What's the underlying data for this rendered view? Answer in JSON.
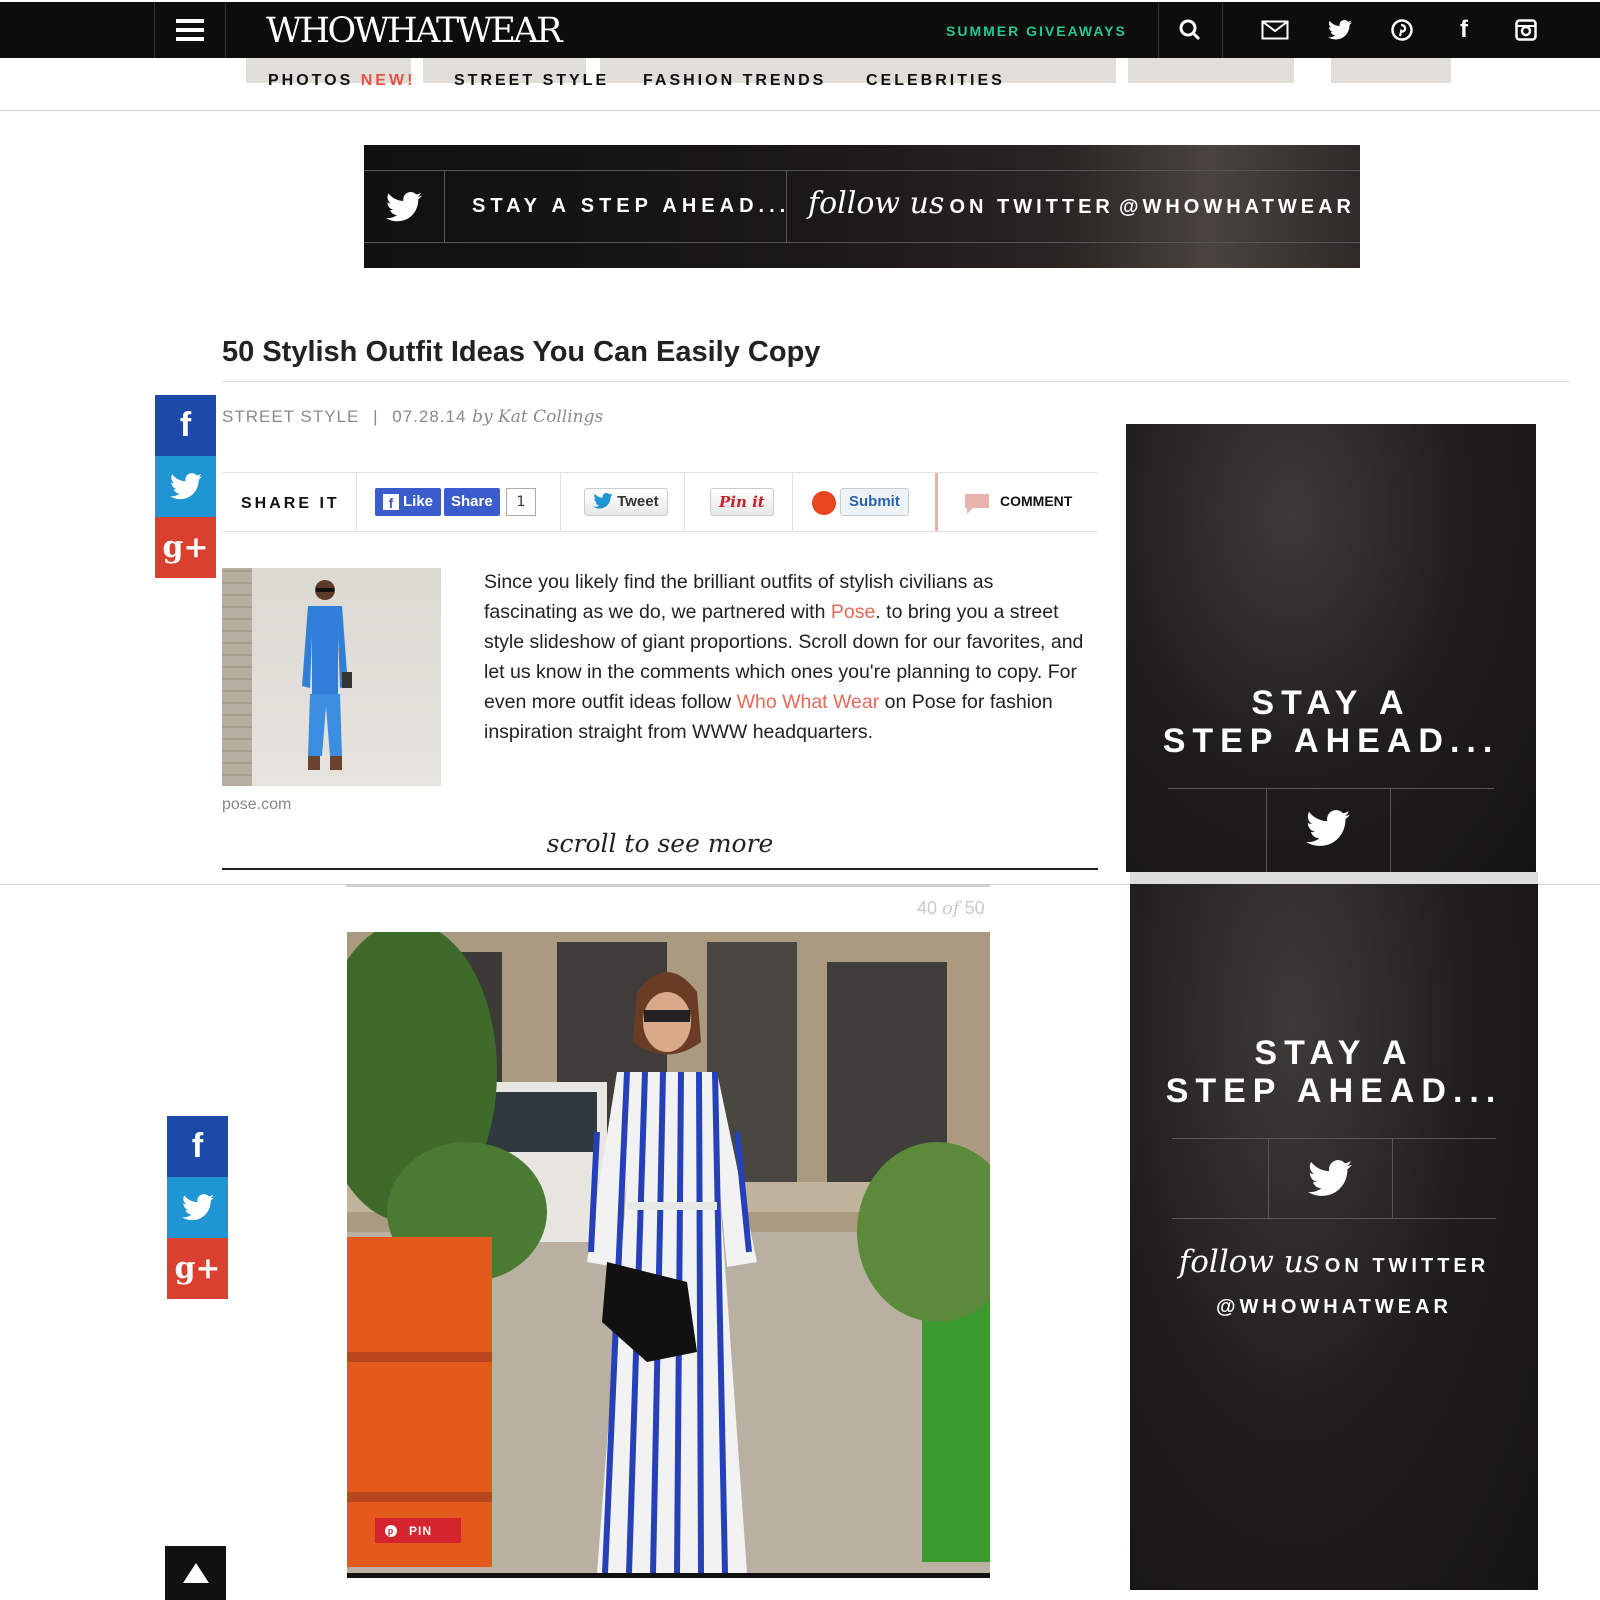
{
  "header": {
    "logo": "WHOWHATWEAR",
    "giveaways": "SUMMER GIVEAWAYS",
    "icons": [
      "menu-icon",
      "search-icon",
      "mail-icon",
      "twitter-icon",
      "pinterest-icon",
      "facebook-icon",
      "instagram-icon"
    ],
    "facebook_glyph": "f"
  },
  "nav": {
    "photos": "PHOTOS",
    "photos_badge": "NEW!",
    "street_style": "STREET STYLE",
    "fashion_trends": "FASHION TRENDS",
    "celebrities": "CELEBRITIES"
  },
  "banner": {
    "tagline": "STAY A STEP AHEAD...",
    "follow_script": "follow us",
    "follow_caps": "ON TWITTER",
    "handle": "@WHOWHATWEAR"
  },
  "article": {
    "title": "50 Stylish Outfit Ideas You Can Easily Copy",
    "category": "STREET STYLE",
    "separator": "|",
    "date": "07.28.14",
    "byline": "by Kat Collings",
    "share_label": "SHARE IT",
    "like_label": "Like",
    "share_button": "Share",
    "share_count": "1",
    "tweet_label": "Tweet",
    "pin_label": "Pin it",
    "submit_label": "Submit",
    "comment_label": "COMMENT",
    "image_source": "pose.com",
    "body_1": "Since you likely find the brilliant outfits of stylish civilians as fascinating as we do, we partnered with ",
    "body_link_1": "Pose",
    "body_2": ". to bring you a street style slideshow of giant proportions. Scroll down for our favorites, and let us know in the comments which ones you're planning to copy. For even more outfit ideas follow ",
    "body_link_2": "Who What Wear",
    "body_3": " on Pose for fashion inspiration straight from WWW headquarters.",
    "scroll_hint": "scroll to see more"
  },
  "social": {
    "facebook": "f",
    "googleplus": "g+"
  },
  "slideshow": {
    "current": "40",
    "of": "of",
    "total": "50",
    "pin_label": "PIN"
  },
  "ads": {
    "headline_line1": "STAY A",
    "headline_line2": "STEP AHEAD...",
    "follow_script": "follow us",
    "follow_caps": "ON TWITTER",
    "handle": "@WHOWHATWEAR"
  },
  "colors": {
    "accent_green": "#25c98f",
    "link": "#e36a5a",
    "facebook": "#1b4aa8",
    "twitter": "#1f95d4",
    "googleplus": "#d9402f",
    "pin": "#d4242e"
  }
}
